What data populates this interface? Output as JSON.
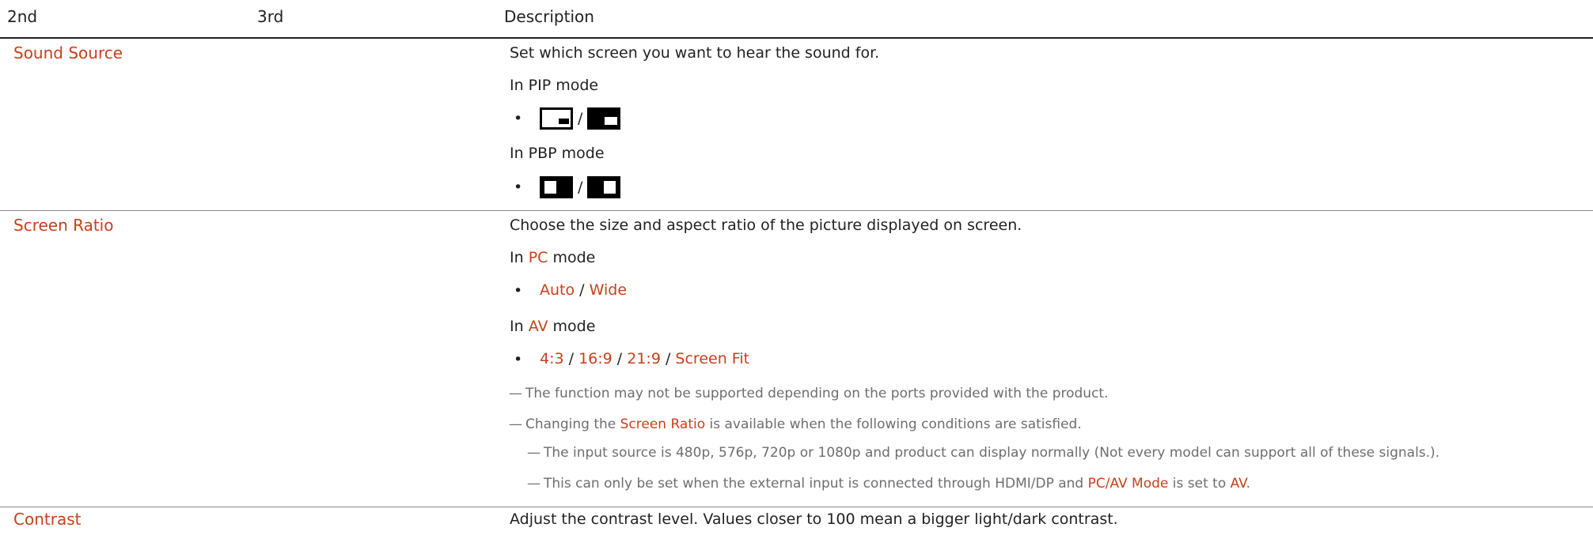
{
  "table": {
    "headers": {
      "col2": "2nd",
      "col3": "3rd",
      "desc": "Description"
    }
  },
  "rows": {
    "sound_source": {
      "label": "Sound Source",
      "desc": "Set which screen you want to hear the sound for.",
      "pip_mode": "In PIP mode",
      "pbp_mode": "In PBP mode",
      "separator": "/"
    },
    "screen_ratio": {
      "label": "Screen Ratio",
      "desc": "Choose the size and aspect ratio of the picture displayed on screen.",
      "pc_in": "In",
      "pc_word": "PC",
      "pc_mode": "mode",
      "pc_options": {
        "auto": "Auto",
        "sep": "/",
        "wide": "Wide"
      },
      "av_in": "In",
      "av_word": "AV",
      "av_mode": "mode",
      "av_options": {
        "o1": "4:3",
        "o2": "16:9",
        "o3": "21:9",
        "o4": "Screen Fit",
        "sep": "/"
      },
      "notes": {
        "dash": "—",
        "n1": "The function may not be supported depending on the ports provided with the product.",
        "n2_pre": "Changing the",
        "n2_term": "Screen Ratio",
        "n2_post": "is available when the following conditions are satisfied.",
        "n3": "The input source is 480p, 576p, 720p or 1080p and product can display normally (Not every model can support all of these signals.).",
        "n4_pre": "This can only be set when the external input is connected through HDMI/DP and",
        "n4_term": "PC/AV Mode",
        "n4_mid": "is set to",
        "n4_val": "AV",
        "n4_end": "."
      }
    },
    "contrast": {
      "label": "Contrast",
      "desc": "Adjust the contrast level. Values closer to 100 mean a bigger light/dark contrast."
    }
  },
  "bullet_glyph": "•",
  "accent_color": "#c8401a"
}
